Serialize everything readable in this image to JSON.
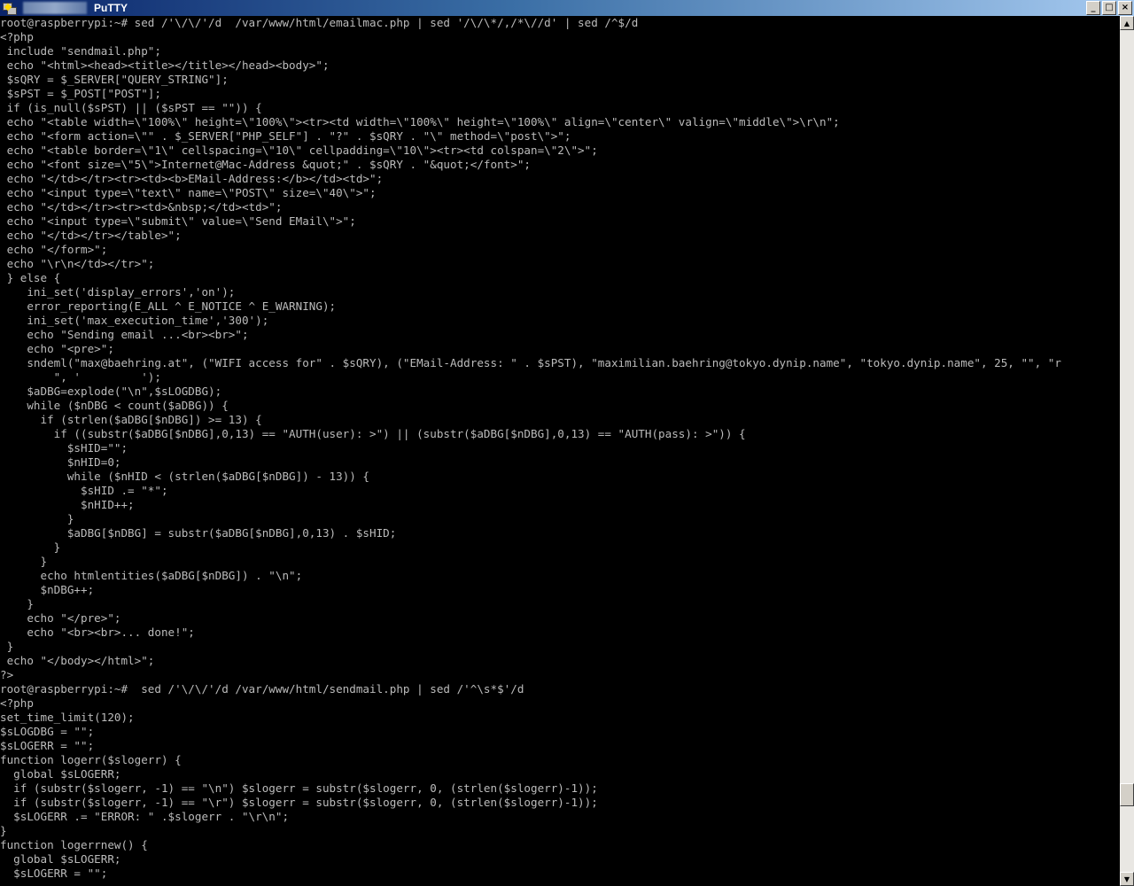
{
  "window": {
    "title": "PuTTY",
    "buttons": {
      "minimize": "_",
      "maximize": "□",
      "close": "×"
    }
  },
  "scroll": {
    "position_fraction": 0.92
  },
  "terminal": {
    "lines": [
      "root@raspberrypi:~# sed /'\\/\\/'/d  /var/www/html/emailmac.php | sed '/\\/\\*/,/*\\//d' | sed /^$/d",
      "<?php",
      " include \"sendmail.php\";",
      " echo \"<html><head><title></title></head><body>\";",
      " $sQRY = $_SERVER[\"QUERY_STRING\"];",
      " $sPST = $_POST[\"POST\"];",
      " if (is_null($sPST) || ($sPST == \"\")) {",
      " echo \"<table width=\\\"100%\\\" height=\\\"100%\\\"><tr><td width=\\\"100%\\\" height=\\\"100%\\\" align=\\\"center\\\" valign=\\\"middle\\\">\\r\\n\";",
      " echo \"<form action=\\\"\" . $_SERVER[\"PHP_SELF\"] . \"?\" . $sQRY . \"\\\" method=\\\"post\\\">\";",
      " echo \"<table border=\\\"1\\\" cellspacing=\\\"10\\\" cellpadding=\\\"10\\\"><tr><td colspan=\\\"2\\\">\";",
      " echo \"<font size=\\\"5\\\">Internet@Mac-Address &quot;\" . $sQRY . \"&quot;</font>\";",
      " echo \"</td></tr><tr><td><b>EMail-Address:</b></td><td>\";",
      " echo \"<input type=\\\"text\\\" name=\\\"POST\\\" size=\\\"40\\\">\";",
      " echo \"</td></tr><tr><td>&nbsp;</td><td>\";",
      " echo \"<input type=\\\"submit\\\" value=\\\"Send EMail\\\">\";",
      " echo \"</td></tr></table>\";",
      " echo \"</form>\";",
      " echo \"\\r\\n</td></tr>\";",
      " } else {",
      "    ini_set('display_errors','on');",
      "    error_reporting(E_ALL ^ E_NOTICE ^ E_WARNING);",
      "    ini_set('max_execution_time','300');",
      "    echo \"Sending email ...<br><br>\";",
      "    echo \"<pre>\";",
      "    sndeml(\"max@baehring.at\", (\"WIFI access for\" . $sQRY), (\"EMail-Address: \" . $sPST), \"maximilian.baehring@tokyo.dynip.name\", \"tokyo.dynip.name\", 25, \"\", \"r",
      "        \", '         ');",
      "    $aDBG=explode(\"\\n\",$sLOGDBG);",
      "    while ($nDBG < count($aDBG)) {",
      "      if (strlen($aDBG[$nDBG]) >= 13) {",
      "        if ((substr($aDBG[$nDBG],0,13) == \"AUTH(user): >\") || (substr($aDBG[$nDBG],0,13) == \"AUTH(pass): >\")) {",
      "          $sHID=\"\";",
      "          $nHID=0;",
      "          while ($nHID < (strlen($aDBG[$nDBG]) - 13)) {",
      "            $sHID .= \"*\";",
      "            $nHID++;",
      "          }",
      "          $aDBG[$nDBG] = substr($aDBG[$nDBG],0,13) . $sHID;",
      "        }",
      "      }",
      "      echo htmlentities($aDBG[$nDBG]) . \"\\n\";",
      "      $nDBG++;",
      "    }",
      "    echo \"</pre>\";",
      "    echo \"<br><br>... done!\";",
      " }",
      " echo \"</body></html>\";",
      "?>",
      "root@raspberrypi:~#  sed /'\\/\\/'/d /var/www/html/sendmail.php | sed /'^\\s*$'/d",
      "<?php",
      "set_time_limit(120);",
      "$sLOGDBG = \"\";",
      "$sLOGERR = \"\";",
      "function logerr($slogerr) {",
      "  global $sLOGERR;",
      "  if (substr($slogerr, -1) == \"\\n\") $slogerr = substr($slogerr, 0, (strlen($slogerr)-1));",
      "  if (substr($slogerr, -1) == \"\\r\") $slogerr = substr($slogerr, 0, (strlen($slogerr)-1));",
      "  $sLOGERR .= \"ERROR: \" .$slogerr . \"\\r\\n\";",
      "}",
      "function logerrnew() {",
      "  global $sLOGERR;",
      "  $sLOGERR = \"\";"
    ]
  }
}
